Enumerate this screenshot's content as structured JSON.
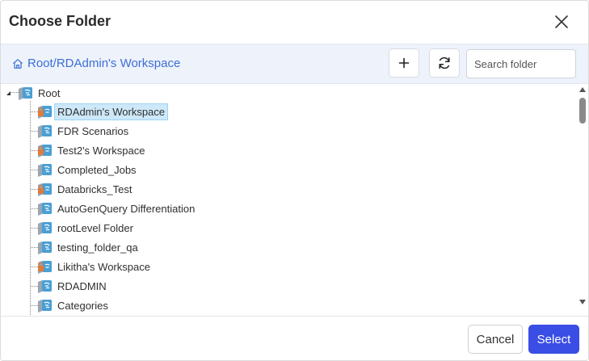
{
  "dialog": {
    "title": "Choose Folder"
  },
  "toolbar": {
    "breadcrumb": "Root/RDAdmin's Workspace",
    "search_placeholder": "Search folder"
  },
  "tree": {
    "root_label": "Root",
    "items": [
      {
        "label": "RDAdmin's Workspace",
        "locked": true,
        "selected": true
      },
      {
        "label": "FDR Scenarios",
        "locked": false
      },
      {
        "label": "Test2's Workspace",
        "locked": true
      },
      {
        "label": "Completed_Jobs",
        "locked": false
      },
      {
        "label": "Databricks_Test",
        "locked": true
      },
      {
        "label": "AutoGenQuery Differentiation",
        "locked": false
      },
      {
        "label": "rootLevel Folder",
        "locked": false
      },
      {
        "label": "testing_folder_qa",
        "locked": false
      },
      {
        "label": "Likitha's Workspace",
        "locked": true
      },
      {
        "label": "RDADMIN",
        "locked": false
      },
      {
        "label": "Categories",
        "locked": false
      }
    ]
  },
  "footer": {
    "cancel_label": "Cancel",
    "select_label": "Select"
  },
  "colors": {
    "accent": "#3a4de4",
    "link": "#3b6fd8",
    "selection": "#cde8f9",
    "folder": "#4a9fd4",
    "lock": "#e07b39"
  }
}
